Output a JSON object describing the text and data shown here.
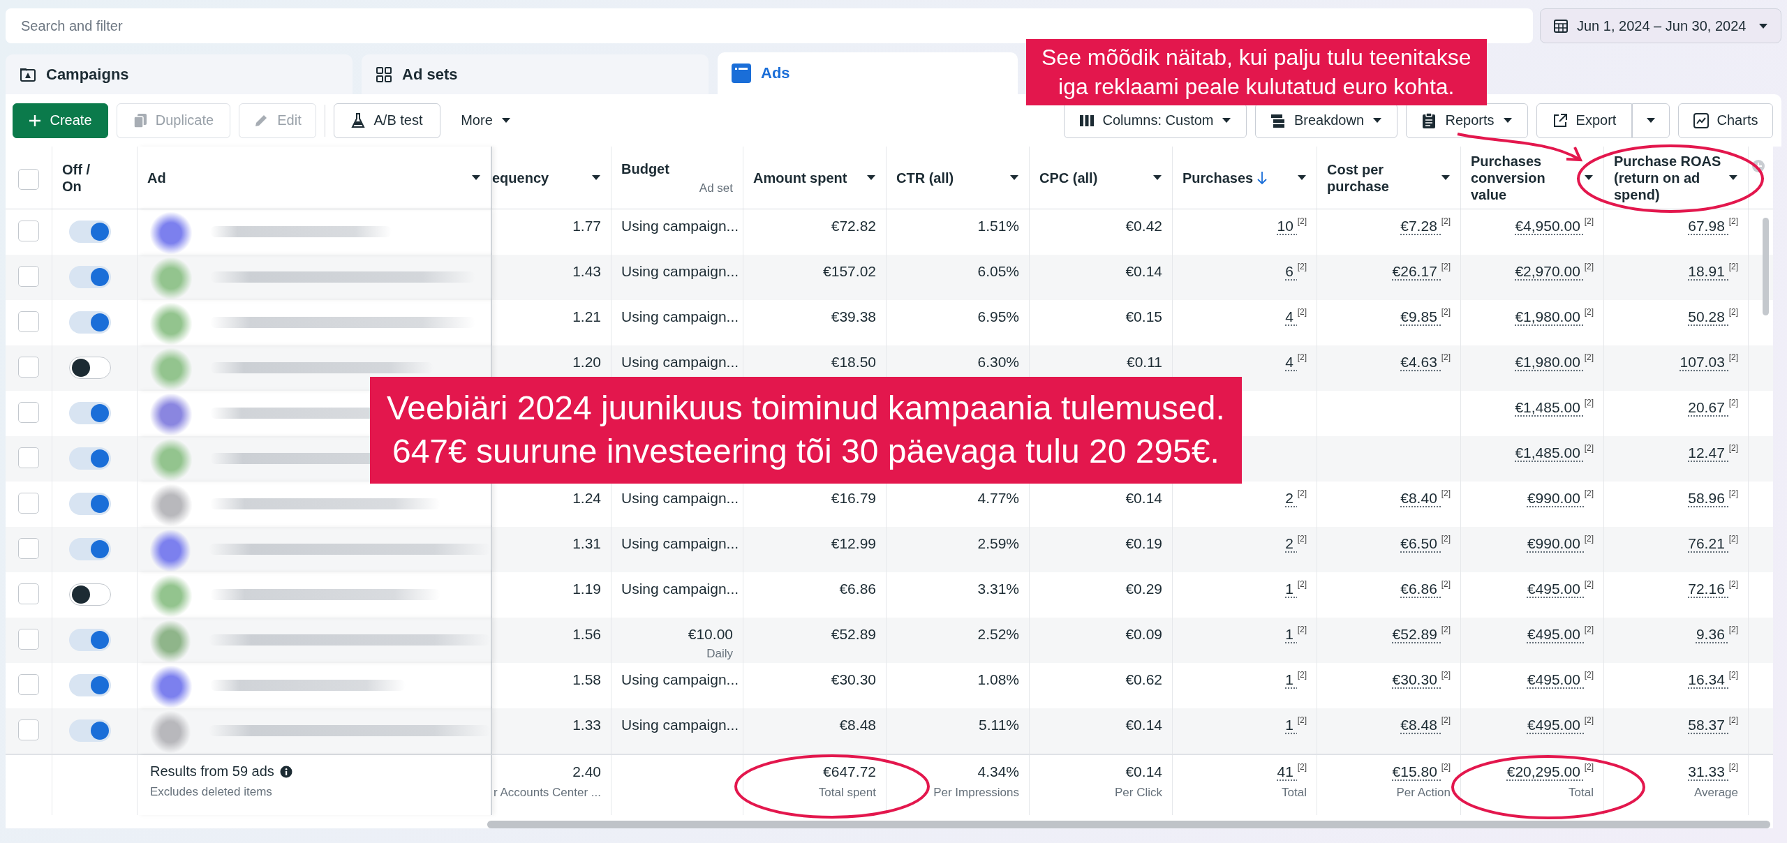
{
  "search": {
    "placeholder": "Search and filter"
  },
  "date_range": {
    "label": "Jun 1, 2024 – Jun 30, 2024"
  },
  "tabs": [
    {
      "label": "Campaigns",
      "selected": false
    },
    {
      "label": "Ad sets",
      "selected": false
    },
    {
      "label": "Ads",
      "selected": true
    }
  ],
  "toolbar": {
    "left": [
      {
        "kind": "create",
        "label": "Create",
        "disabled": false
      },
      {
        "kind": "duplicate",
        "label": "Duplicate",
        "disabled": true
      },
      {
        "kind": "edit",
        "label": "Edit",
        "disabled": true
      },
      {
        "kind": "abtest",
        "label": "A/B test",
        "disabled": false
      },
      {
        "kind": "more",
        "label": "More",
        "disabled": false
      }
    ],
    "right": [
      {
        "kind": "columns",
        "label": "Columns: Custom",
        "disabled": false
      },
      {
        "kind": "breakdown",
        "label": "Breakdown",
        "disabled": false
      },
      {
        "kind": "reports",
        "label": "Reports",
        "disabled": false
      },
      {
        "kind": "export",
        "label": "Export",
        "disabled": false
      },
      {
        "kind": "menu",
        "disabled": false
      },
      {
        "kind": "charts",
        "label": "Charts",
        "disabled": false
      }
    ]
  },
  "table": {
    "select_all": {
      "checked": false
    },
    "columns": [
      {
        "label": "Off / On",
        "menu": false,
        "sorted": false
      },
      {
        "label": "Ad",
        "menu": true,
        "sorted": false
      },
      {
        "label": "equency",
        "menu": true,
        "sorted": false
      },
      {
        "label": "Budget",
        "sub": "Ad set",
        "menu": false,
        "sorted": false
      },
      {
        "label": "Amount spent",
        "menu": true,
        "sorted": false
      },
      {
        "label": "CTR (all)",
        "menu": true,
        "sorted": false
      },
      {
        "label": "CPC (all)",
        "menu": true,
        "sorted": false
      },
      {
        "label": "Purchases",
        "menu": true,
        "sorted": true
      },
      {
        "label": "Cost per purchase",
        "menu": true,
        "sorted": false
      },
      {
        "label": "Purchases conversion value",
        "menu": true,
        "sorted": false
      },
      {
        "label": "Purchase ROAS (return on ad spend)",
        "menu": true,
        "sorted": false
      }
    ],
    "rows": [
      {
        "checked": false,
        "on": true,
        "color": "#7c80ee",
        "frequency": "1.77",
        "budget": "Using campaign...",
        "spent": "€72.82",
        "ctr": "1.51%",
        "cpc": "€0.42",
        "purchases": "10 $^{[2]}$",
        "cost": "€7.28 $^{[2]}$",
        "value": "€4,950.00 $^{[2]}$",
        "roas": "67.98 $^{[2]}$"
      },
      {
        "checked": false,
        "on": true,
        "color": "#93c48e",
        "frequency": "1.43",
        "budget": "Using campaign...",
        "spent": "€157.02",
        "ctr": "6.05%",
        "cpc": "€0.14",
        "purchases": "6 $^{[2]}$",
        "cost": "€26.17 $^{[2]}$",
        "value": "€2,970.00 $^{[2]}$",
        "roas": "18.91 $^{[2]}$"
      },
      {
        "checked": false,
        "on": true,
        "color": "#93c48e",
        "frequency": "1.21",
        "budget": "Using campaign...",
        "spent": "€39.38",
        "ctr": "6.95%",
        "cpc": "€0.15",
        "purchases": "4 $^{[2]}$",
        "cost": "€9.85 $^{[2]}$",
        "value": "€1,980.00 $^{[2]}$",
        "roas": "50.28 $^{[2]}$"
      },
      {
        "checked": false,
        "on": false,
        "color": "#93c48e",
        "frequency": "1.20",
        "budget": "Using campaign...",
        "spent": "€18.50",
        "ctr": "6.30%",
        "cpc": "€0.11",
        "purchases": "4 $^{[2]}$",
        "cost": "€4.63 $^{[2]}$",
        "value": "€1,980.00 $^{[2]}$",
        "roas": "107.03 $^{[2]}$"
      },
      {
        "checked": false,
        "on": true,
        "color": "#8a86e0",
        "value": "€1,485.00 $^{[2]}$",
        "roas": "20.67 $^{[2]}$"
      },
      {
        "checked": false,
        "on": true,
        "color": "#93c48e",
        "value": "€1,485.00 $^{[2]}$",
        "roas": "12.47 $^{[2]}$"
      },
      {
        "checked": false,
        "on": true,
        "color": "#b8b8bc",
        "frequency": "1.24",
        "budget": "Using campaign...",
        "spent": "€16.79",
        "ctr": "4.77%",
        "cpc": "€0.14",
        "purchases": "2 $^{[2]}$",
        "cost": "€8.40 $^{[2]}$",
        "value": "€990.00 $^{[2]}$",
        "roas": "58.96 $^{[2]}$"
      },
      {
        "checked": false,
        "on": true,
        "color": "#7c80ee",
        "frequency": "1.31",
        "budget": "Using campaign...",
        "spent": "€12.99",
        "ctr": "2.59%",
        "cpc": "€0.19",
        "purchases": "2 $^{[2]}$",
        "cost": "€6.50 $^{[2]}$",
        "value": "€990.00 $^{[2]}$",
        "roas": "76.21 $^{[2]}$"
      },
      {
        "checked": false,
        "on": false,
        "color": "#93c48e",
        "frequency": "1.19",
        "budget": "Using campaign...",
        "spent": "€6.86",
        "ctr": "3.31%",
        "cpc": "€0.29",
        "purchases": "1 $^{[2]}$",
        "cost": "€6.86 $^{[2]}$",
        "value": "€495.00 $^{[2]}$",
        "roas": "72.16 $^{[2]}$"
      },
      {
        "checked": false,
        "on": true,
        "color": "#8fb58a",
        "frequency": "1.56",
        "budget": "€10.00",
        "budget_period": "Daily",
        "spent": "€52.89",
        "ctr": "2.52%",
        "cpc": "€0.09",
        "purchases": "1 $^{[2]}$",
        "cost": "€52.89 $^{[2]}$",
        "value": "€495.00 $^{[2]}$",
        "roas": "9.36 $^{[2]}$"
      },
      {
        "checked": false,
        "on": true,
        "color": "#7c80ee",
        "frequency": "1.58",
        "budget": "Using campaign...",
        "spent": "€30.30",
        "ctr": "1.08%",
        "cpc": "€0.62",
        "purchases": "1 $^{[2]}$",
        "cost": "€30.30 $^{[2]}$",
        "value": "€495.00 $^{[2]}$",
        "roas": "16.34 $^{[2]}$"
      },
      {
        "checked": false,
        "on": true,
        "color": "#b8b8bc",
        "frequency": "1.33",
        "budget": "Using campaign...",
        "spent": "€8.48",
        "ctr": "5.11%",
        "cpc": "€0.14",
        "purchases": "1 $^{[2]}$",
        "cost": "€8.48 $^{[2]}$",
        "value": "€495.00 $^{[2]}$",
        "roas": "58.37 $^{[2]}$"
      }
    ],
    "footer": {
      "title": "Results from 59 ads",
      "subtitle": "Excludes deleted items",
      "frequency": {
        "value": "2.40",
        "label": "r Accounts Center ..."
      },
      "spent": {
        "value": "€647.72",
        "label": "Total spent"
      },
      "ctr": {
        "value": "4.34%",
        "label": "Per Impressions"
      },
      "cpc": {
        "value": "€0.14",
        "label": "Per Click"
      },
      "purchases": {
        "value": "41 $^{[2]}$",
        "label": "Total"
      },
      "cost": {
        "value": "€15.80 $^{[2]}$",
        "label": "Per Action"
      },
      "value": {
        "value": "€20,295.00 $^{[2]}$",
        "label": "Total"
      },
      "roas": {
        "value": "31.33 $^{[2]}$",
        "label": "Average"
      }
    }
  },
  "annotations": [
    {
      "lines": [
        "See mõõdik näitab, kui palju tulu teenitakse",
        "iga reklaami peale kulutatud euro kohta."
      ]
    },
    {
      "lines": [
        "Veebiäri 2024 juunikuus toiminud kampaania tulemused.",
        "647€ suurune investeering tõi 30 päevaga tulu 20 295€."
      ]
    }
  ]
}
